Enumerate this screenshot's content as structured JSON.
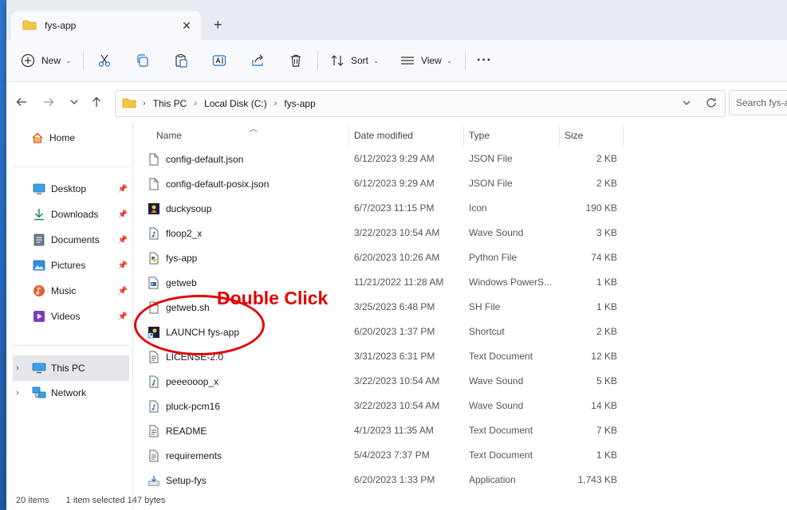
{
  "window": {
    "tab_title": "fys-app",
    "tab_close": "✕",
    "tab_add": "+"
  },
  "toolbar": {
    "new_label": "New",
    "sort_label": "Sort",
    "view_label": "View",
    "more_label": "···"
  },
  "address": {
    "crumbs": [
      "This PC",
      "Local Disk (C:)",
      "fys-app"
    ],
    "search_placeholder": "Search fys-app"
  },
  "sidebar": {
    "home": "Home",
    "quick": [
      {
        "label": "Desktop"
      },
      {
        "label": "Downloads"
      },
      {
        "label": "Documents"
      },
      {
        "label": "Pictures"
      },
      {
        "label": "Music"
      },
      {
        "label": "Videos"
      }
    ],
    "this_pc": "This PC",
    "network": "Network"
  },
  "columns": {
    "name": "Name",
    "date": "Date modified",
    "type": "Type",
    "size": "Size"
  },
  "files": [
    {
      "name": "config-default.json",
      "date": "6/12/2023 9:29 AM",
      "type": "JSON File",
      "size": "2 KB",
      "icon": "document-icon"
    },
    {
      "name": "config-default-posix.json",
      "date": "6/12/2023 9:29 AM",
      "type": "JSON File",
      "size": "2 KB",
      "icon": "document-icon"
    },
    {
      "name": "duckysoup",
      "date": "6/7/2023 11:15 PM",
      "type": "Icon",
      "size": "190 KB",
      "icon": "image-icon"
    },
    {
      "name": "floop2_x",
      "date": "3/22/2023 10:54 AM",
      "type": "Wave Sound",
      "size": "3 KB",
      "icon": "audio-icon"
    },
    {
      "name": "fys-app",
      "date": "6/20/2023 10:26 AM",
      "type": "Python File",
      "size": "74 KB",
      "icon": "python-icon"
    },
    {
      "name": "getweb",
      "date": "11/21/2022 11:28 AM",
      "type": "Windows PowerS...",
      "size": "1 KB",
      "icon": "script-icon"
    },
    {
      "name": "getweb.sh",
      "date": "3/25/2023 6:48 PM",
      "type": "SH File",
      "size": "1 KB",
      "icon": "document-icon"
    },
    {
      "name": "LAUNCH fys-app",
      "date": "6/20/2023 1:37 PM",
      "type": "Shortcut",
      "size": "2 KB",
      "icon": "shortcut-icon"
    },
    {
      "name": "LICENSE-2.0",
      "date": "3/31/2023 6:31 PM",
      "type": "Text Document",
      "size": "12 KB",
      "icon": "text-icon"
    },
    {
      "name": "peeeooop_x",
      "date": "3/22/2023 10:54 AM",
      "type": "Wave Sound",
      "size": "5 KB",
      "icon": "audio-icon"
    },
    {
      "name": "pluck-pcm16",
      "date": "3/22/2023 10:54 AM",
      "type": "Wave Sound",
      "size": "14 KB",
      "icon": "audio-icon"
    },
    {
      "name": "README",
      "date": "4/1/2023 11:35 AM",
      "type": "Text Document",
      "size": "7 KB",
      "icon": "text-icon"
    },
    {
      "name": "requirements",
      "date": "5/4/2023 7:37 PM",
      "type": "Text Document",
      "size": "1 KB",
      "icon": "text-icon"
    },
    {
      "name": "Setup-fys",
      "date": "6/20/2023 1:33 PM",
      "type": "Application",
      "size": "1,743 KB",
      "icon": "installer-icon"
    }
  ],
  "annotation": {
    "text": "Double Click",
    "color": "#e30000"
  },
  "status": {
    "items": "20 items",
    "selected": "1 item selected  147 bytes"
  }
}
